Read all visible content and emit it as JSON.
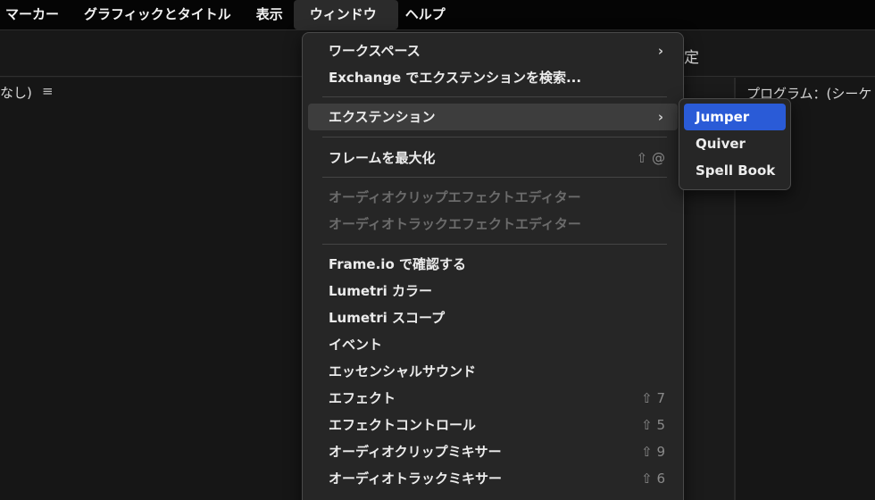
{
  "menubar": {
    "items": [
      {
        "label": "マーカー"
      },
      {
        "label": "グラフィックとタイトル"
      },
      {
        "label": "表示"
      },
      {
        "label": "ウィンドウ"
      },
      {
        "label": "ヘルプ"
      }
    ]
  },
  "background": {
    "left_label": "なし)",
    "menu_icon": "≡",
    "header_right": "定",
    "program_label": "プログラム：(シーケ"
  },
  "window_menu": {
    "items": [
      {
        "label": "ワークスペース",
        "chevron": "›"
      },
      {
        "label": "Exchange でエクステンションを検索..."
      },
      {
        "label": "エクステンション",
        "chevron": "›"
      },
      {
        "label": "フレームを最大化",
        "shortcut": "⇧ @"
      },
      {
        "label": "オーディオクリップエフェクトエディター"
      },
      {
        "label": "オーディオトラックエフェクトエディター"
      },
      {
        "label": "Frame.io で確認する"
      },
      {
        "label": "Lumetri カラー"
      },
      {
        "label": "Lumetri スコープ"
      },
      {
        "label": "イベント"
      },
      {
        "label": "エッセンシャルサウンド"
      },
      {
        "label": "エフェクト",
        "shortcut": "⇧ 7"
      },
      {
        "label": "エフェクトコントロール",
        "shortcut": "⇧ 5"
      },
      {
        "label": "オーディオクリップミキサー",
        "shortcut": "⇧ 9"
      },
      {
        "label": "オーディオトラックミキサー",
        "shortcut": "⇧ 6"
      }
    ]
  },
  "extensions_submenu": {
    "items": [
      {
        "label": "Jumper"
      },
      {
        "label": "Quiver"
      },
      {
        "label": "Spell Book"
      }
    ]
  },
  "colors": {
    "selection": "#2a5bd7",
    "menu_bg": "#262626",
    "disabled_text": "#6b6b6b"
  }
}
